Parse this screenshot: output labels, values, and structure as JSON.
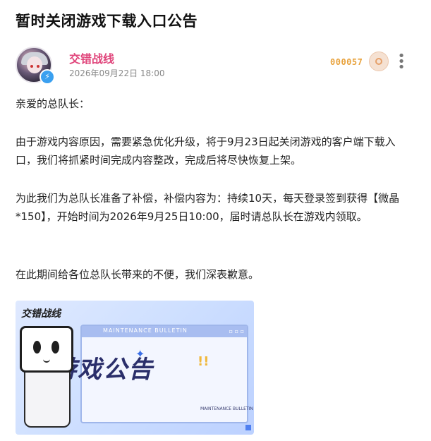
{
  "post": {
    "title": "暂时关闭游戏下载入口公告"
  },
  "author": {
    "name": "交错战线",
    "date": "2026年09月22日 18:00",
    "level": "000057",
    "verified_icon": "lightning-icon"
  },
  "content": {
    "p1": "亲爱的总队长：",
    "p2": "由于游戏内容原因，需要紧急优化升级，将于9月23日起关闭游戏的客户端下载入口，我们将抓紧时间完成内容整改，完成后将尽快恢复上架。",
    "p3": "为此我们为总队长准备了补偿，补偿内容为：持续10天，每天登录签到获得【微晶*150】，开始时间为2026年9月25日10:00，届时请总队长在游戏内领取。",
    "p4": "在此期间给各位总队长带来的不便，我们深表歉意。"
  },
  "banner": {
    "logo": "交错战线",
    "bar_text": "MAINTENANCE BULLETIN",
    "big_text": "游戏公告",
    "small_tag": "MAINTENANCE BULLETIN"
  },
  "colors": {
    "author_name": "#e0457b",
    "level_text": "#e8a23c",
    "verified": "#3aa0f0"
  }
}
